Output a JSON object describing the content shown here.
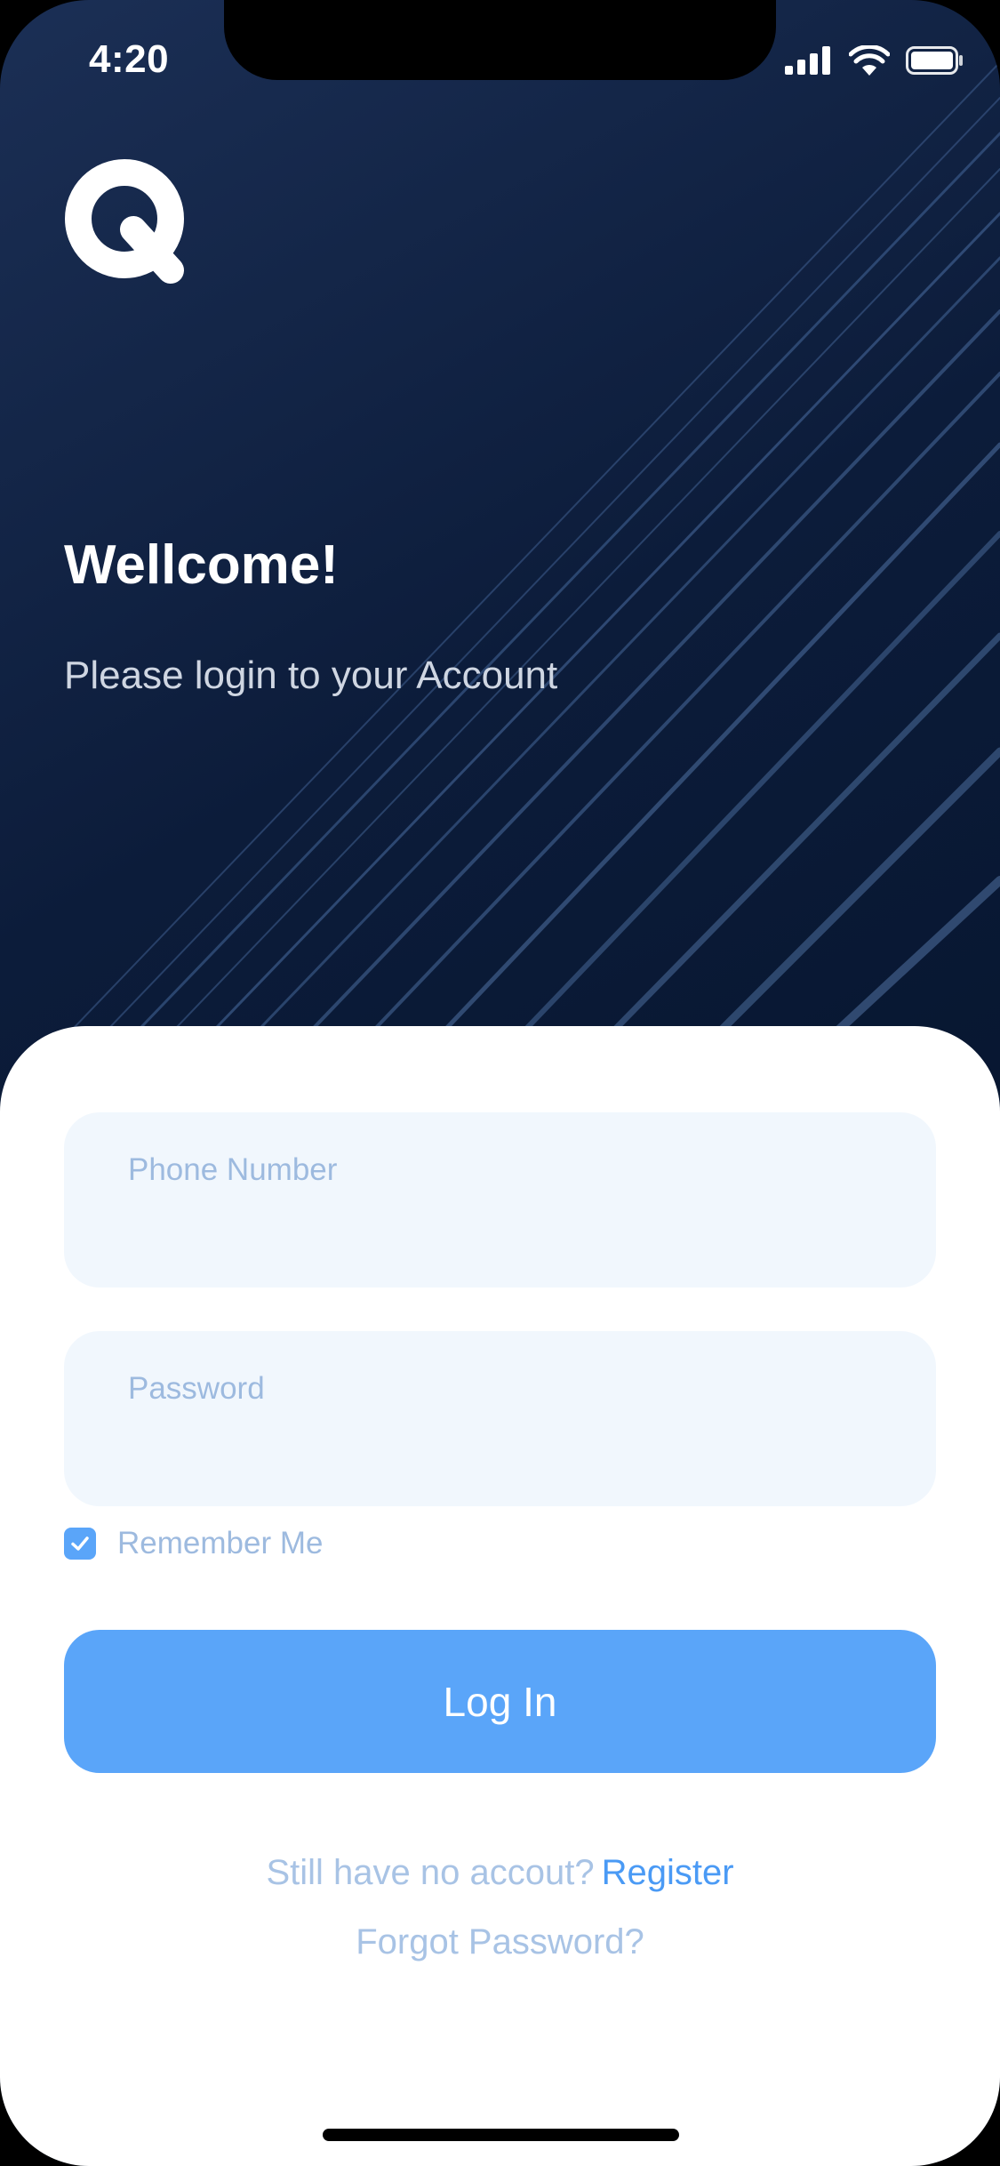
{
  "status_bar": {
    "time": "4:20",
    "icons": [
      "signal-icon",
      "wifi-icon",
      "battery-icon"
    ]
  },
  "brand": {
    "logo": "q-logo-icon"
  },
  "header": {
    "title": "Wellcome!",
    "subtitle": "Please login to your Account"
  },
  "form": {
    "phone_placeholder": "Phone Number",
    "password_placeholder": "Password",
    "remember_label": "Remember Me",
    "remember_checked": true,
    "login_label": "Log In"
  },
  "footer": {
    "register_prompt": "Still have no accout?",
    "register_link": "Register",
    "forgot_link": "Forgot Password?"
  },
  "colors": {
    "accent": "#5aa5f9",
    "link": "#4a9af5",
    "field_bg": "#f1f7fd",
    "placeholder": "#9dbadf",
    "header_bg": "#06152e"
  }
}
